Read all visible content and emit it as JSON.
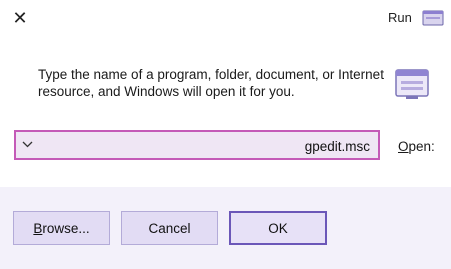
{
  "window": {
    "title": "Run",
    "close_glyph": "✕",
    "icon": "run-app-icon"
  },
  "main": {
    "description": "Type the name of a program, folder, document, or Internet resource, and Windows will open it for you.",
    "icon": "run-dialog-icon",
    "open_label_accel": "O",
    "open_label_rest": "pen:",
    "combo": {
      "value": "gpedit.msc",
      "dropdown_icon": "chevron-down-icon"
    }
  },
  "buttons": {
    "ok": "OK",
    "cancel": "Cancel",
    "browse_accel": "B",
    "browse_rest": "rowse..."
  },
  "colors": {
    "accent": "#6b57b8",
    "input_border": "#c45ab7",
    "footer_bg": "#f3f1fa",
    "button_bg": "#e2dcf4"
  }
}
